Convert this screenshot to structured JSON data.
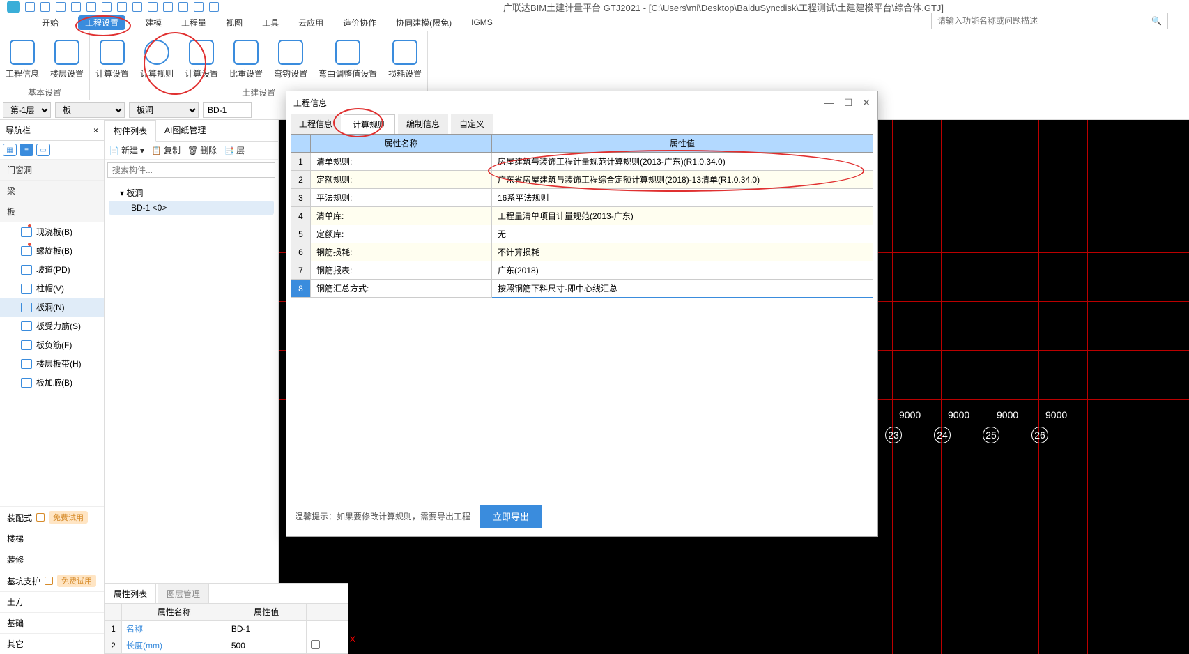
{
  "app": {
    "title": "广联达BIM土建计量平台 GTJ2021 - [C:\\Users\\mi\\Desktop\\BaiduSyncdisk\\工程测试\\土建建模平台\\综合体.GTJ]"
  },
  "menu": {
    "items": [
      "开始",
      "工程设置",
      "建模",
      "工程量",
      "视图",
      "工具",
      "云应用",
      "造价协作",
      "协同建模(限免)",
      "IGMS"
    ],
    "active": "工程设置",
    "search_placeholder": "请输入功能名称或问题描述"
  },
  "ribbon": {
    "groups": [
      {
        "label": "基本设置",
        "buttons": [
          "工程信息",
          "楼层设置"
        ]
      },
      {
        "label": "土建设置",
        "buttons": [
          "计算设置",
          "计算规则",
          "计算设置",
          "比重设置",
          "弯钩设置",
          "弯曲调整值设置",
          "损耗设置"
        ]
      }
    ]
  },
  "selectors": {
    "floor": "第-1层",
    "category": "板",
    "subcat": "板洞",
    "component": "BD-1"
  },
  "navbar": {
    "title": "导航栏",
    "sections": [
      "门窗洞",
      "梁",
      "板"
    ],
    "board_items": [
      {
        "label": "现浇板(B)",
        "dot": true
      },
      {
        "label": "螺旋板(B)",
        "dot": true
      },
      {
        "label": "坡道(PD)",
        "dot": false
      },
      {
        "label": "柱帽(V)",
        "dot": false
      },
      {
        "label": "板洞(N)",
        "dot": false,
        "sel": true
      },
      {
        "label": "板受力筋(S)",
        "dot": false
      },
      {
        "label": "板负筋(F)",
        "dot": false
      },
      {
        "label": "楼层板带(H)",
        "dot": false
      },
      {
        "label": "板加腋(B)",
        "dot": false
      }
    ],
    "footer": [
      {
        "label": "装配式",
        "lock": true,
        "badge": "免费试用"
      },
      {
        "label": "楼梯"
      },
      {
        "label": "装修"
      },
      {
        "label": "基坑支护",
        "lock": true,
        "badge": "免费试用"
      },
      {
        "label": "土方"
      },
      {
        "label": "基础"
      },
      {
        "label": "其它"
      }
    ]
  },
  "middle": {
    "tabs": [
      "构件列表",
      "AI图纸管理"
    ],
    "toolbar": {
      "new": "新建",
      "copy": "复制",
      "delete": "删除",
      "layers": "层"
    },
    "search_placeholder": "搜索构件...",
    "tree_root": "板洞",
    "tree_leaf": "BD-1 <0>"
  },
  "prop_panel": {
    "tabs": [
      "属性列表",
      "图层管理"
    ],
    "headers": [
      "",
      "属性名称",
      "属性值",
      ""
    ],
    "rows": [
      {
        "n": "1",
        "name": "名称",
        "val": "BD-1",
        "chk": false
      },
      {
        "n": "2",
        "name": "长度(mm)",
        "val": "500",
        "chk": false
      }
    ]
  },
  "dialog": {
    "title": "工程信息",
    "tabs": [
      "工程信息",
      "计算规则",
      "编制信息",
      "自定义"
    ],
    "active_tab": "计算规则",
    "headers": {
      "name": "属性名称",
      "value": "属性值"
    },
    "rows": [
      {
        "n": "1",
        "name": "清单规则:",
        "val": "房屋建筑与装饰工程计量规范计算规则(2013-广东)(R1.0.34.0)"
      },
      {
        "n": "2",
        "name": "定额规则:",
        "val": "广东省房屋建筑与装饰工程综合定额计算规则(2018)-13清单(R1.0.34.0)"
      },
      {
        "n": "3",
        "name": "平法规则:",
        "val": "16系平法规则"
      },
      {
        "n": "4",
        "name": "清单库:",
        "val": "工程量清单项目计量规范(2013-广东)"
      },
      {
        "n": "5",
        "name": "定额库:",
        "val": "无"
      },
      {
        "n": "6",
        "name": "钢筋损耗:",
        "val": "不计算损耗"
      },
      {
        "n": "7",
        "name": "钢筋报表:",
        "val": "广东(2018)"
      },
      {
        "n": "8",
        "name": "钢筋汇总方式:",
        "val": "按照钢筋下料尺寸-即中心线汇总",
        "sel": true
      }
    ],
    "footer_hint": "温馨提示：如果要修改计算规则，需要导出工程",
    "export_btn": "立即导出"
  },
  "canvas": {
    "dims": [
      "9000",
      "9000",
      "9000",
      "9000"
    ],
    "axes": [
      "23",
      "24",
      "25",
      "26"
    ]
  }
}
